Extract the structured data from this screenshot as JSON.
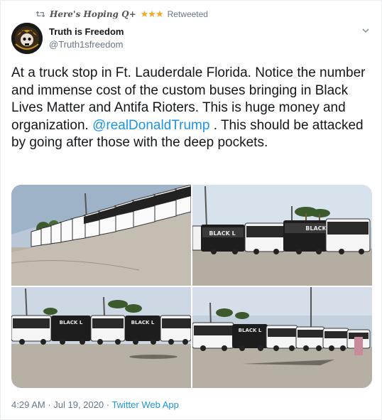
{
  "retweet": {
    "retweeter": "Here's Hoping Q+",
    "stars": "★★★",
    "label": "Retweeted"
  },
  "author": {
    "name": "Truth is Freedom",
    "handle": "@Truth1sfreedom"
  },
  "tweet": {
    "text_before": "At a truck stop in Ft. Lauderdale Florida.  Notice the number and immense cost of the custom buses bringing in  Black Lives Matter and Antifa Rioters.  This is huge money and organization.  ",
    "mention": "@realDonaldTrump",
    "text_after": " . This should be attacked by going after those with the deep pockets."
  },
  "media": {
    "bus_label": "BLACK L",
    "bus_label_short": "BLACK"
  },
  "meta": {
    "time": "4:29 AM",
    "separator1": " · ",
    "date": "Jul 19, 2020",
    "separator2": " · ",
    "source": "Twitter Web App"
  },
  "icons": {
    "retweet": "retweet-icon",
    "caret": "chevron-down-icon",
    "avatar": "avatar"
  },
  "colors": {
    "link": "#1b95e0",
    "secondary_text": "#657786",
    "stars": "#f5a623"
  }
}
